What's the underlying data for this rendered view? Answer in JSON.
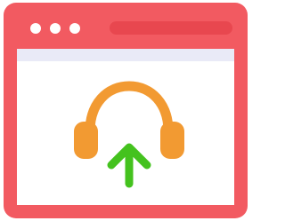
{
  "window": {
    "frame_color": "#f25a61",
    "address_bar_color": "#e8474f",
    "content_bg": "#ffffff",
    "content_stripe_color": "#e9eaf7"
  },
  "titlebar": {
    "controls": [
      "window-dot-icon",
      "window-dot-icon",
      "window-dot-icon"
    ]
  },
  "illustration": {
    "headphones_icon": "headphones-icon",
    "headphones_color": "#f29a32",
    "upload_arrow_icon": "upload-arrow-icon",
    "arrow_color": "#44c21e"
  }
}
